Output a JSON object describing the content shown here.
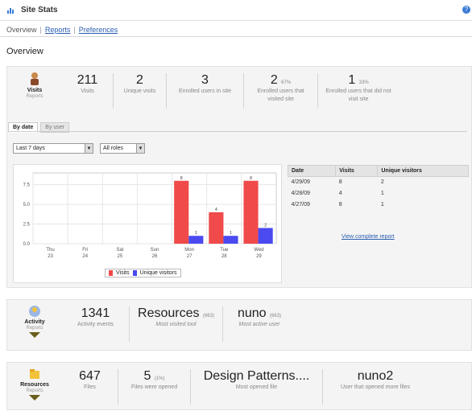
{
  "header": {
    "title": "Site Stats"
  },
  "nav": {
    "overview": "Overview",
    "sep1": "|",
    "reports": "Reports",
    "sep2": "|",
    "preferences": "Preferences"
  },
  "page_title": "Overview",
  "visits_panel": {
    "tool_name": "Visits",
    "tool_sub": "Reports",
    "stats": [
      {
        "value": "211",
        "unit": "",
        "label": "Visits"
      },
      {
        "value": "2",
        "unit": "",
        "label": "Unique visits"
      },
      {
        "value": "3",
        "unit": "",
        "label": "Enrolled users in site"
      },
      {
        "value": "2",
        "unit": "67%",
        "label": "Enrolled users that visited site"
      },
      {
        "value": "1",
        "unit": "33%",
        "label": "Enrolled users that did not visit site"
      }
    ],
    "tabs": [
      "By date",
      "By user"
    ],
    "select_period": "Last 7 days",
    "select_roles": "All roles",
    "table": {
      "headers": [
        "Date",
        "Visits",
        "Unique visitors"
      ],
      "rows": [
        [
          "4/29/09",
          "8",
          "2"
        ],
        [
          "4/28/09",
          "4",
          "1"
        ],
        [
          "4/27/09",
          "8",
          "1"
        ]
      ]
    },
    "view_report": "View complete report",
    "legend": [
      "Visits",
      "Unique visitors"
    ]
  },
  "chart_data": {
    "type": "bar",
    "categories": [
      "Thu 23",
      "Fri 24",
      "Sat 25",
      "Sun 26",
      "Mon 27",
      "Tue 28",
      "Wed 29"
    ],
    "series": [
      {
        "name": "Visits",
        "values": [
          0,
          0,
          0,
          0,
          8,
          4,
          8
        ],
        "color": "#f04a4a"
      },
      {
        "name": "Unique visitors",
        "values": [
          0,
          0,
          0,
          0,
          1,
          1,
          2
        ],
        "color": "#4a4af0"
      }
    ],
    "yticks": [
      "0.0",
      "2.5",
      "5.0",
      "7.5"
    ],
    "ylim": [
      0,
      9
    ],
    "grid": true,
    "legend_position": "bottom"
  },
  "activity_panel": {
    "tool_name": "Activity",
    "tool_sub": "Reports",
    "stats": [
      {
        "value": "1341",
        "unit": "",
        "label": "Activity events"
      },
      {
        "value": "Resources",
        "unit": "(663)",
        "label": "Most visited tool"
      },
      {
        "value": "nuno",
        "unit": "(663)",
        "label": "Most active user"
      }
    ]
  },
  "resources_panel": {
    "tool_name": "Resources",
    "tool_sub": "Reports",
    "stats": [
      {
        "value": "647",
        "unit": "",
        "label": "Files"
      },
      {
        "value": "5",
        "unit": "(1%)",
        "label": "Files were opened"
      },
      {
        "value": "Design Patterns....",
        "unit": "",
        "label": "Most opened file"
      },
      {
        "value": "nuno2",
        "unit": "",
        "label": "User that opened more files"
      }
    ]
  },
  "colors": {
    "visits": "#f04a4a",
    "unique": "#4a4af0",
    "link": "#2a5db0"
  }
}
